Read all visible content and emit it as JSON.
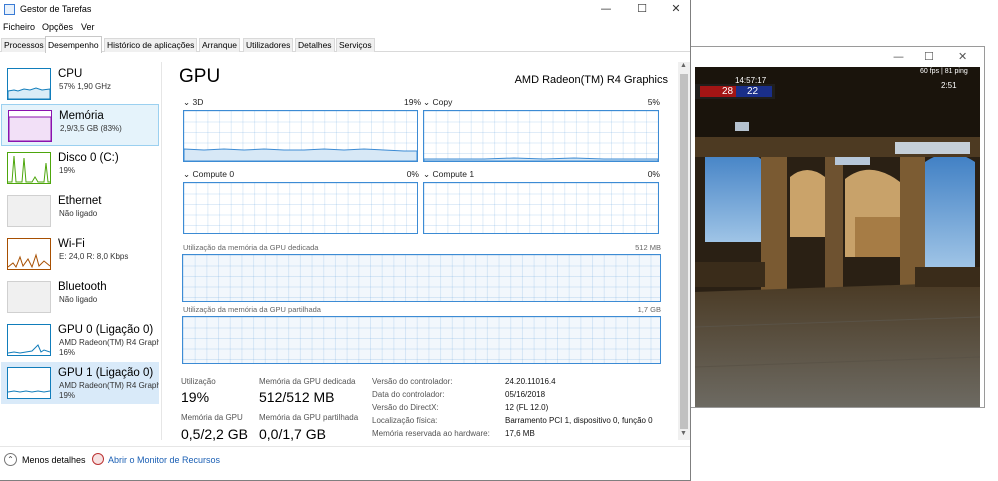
{
  "window": {
    "title": "Gestor de Tarefas",
    "minimize_glyph": "—",
    "maximize_glyph": "☐",
    "close_glyph": "✕"
  },
  "menu": [
    "Ficheiro",
    "Opções",
    "Ver"
  ],
  "tabs": [
    "Processos",
    "Desempenho",
    "Histórico de aplicações",
    "Arranque",
    "Utilizadores",
    "Detalhes",
    "Serviços"
  ],
  "sidebar": {
    "items": [
      {
        "name": "CPU",
        "sub": "57%  1,90 GHz",
        "thumb_color": "#117dbb"
      },
      {
        "name": "Memória",
        "sub": "2,9/3,5 GB (83%)",
        "thumb_color": "#8b12ae"
      },
      {
        "name": "Disco 0 (C:)",
        "sub": "19%",
        "thumb_color": "#4da60c"
      },
      {
        "name": "Ethernet",
        "sub": "Não ligado",
        "thumb_color": "#a74f01"
      },
      {
        "name": "Wi-Fi",
        "sub": "E: 24,0  R: 8,0 Kbps",
        "thumb_color": "#a74f01"
      },
      {
        "name": "Bluetooth",
        "sub": "Não ligado",
        "thumb_color": "#a74f01"
      },
      {
        "name": "GPU 0 (Ligação 0)",
        "sub": "AMD Radeon(TM) R4 Graphics",
        "sub2": "16%",
        "thumb_color": "#117dbb"
      },
      {
        "name": "GPU 1 (Ligação 0)",
        "sub": "AMD Radeon(TM) R4 Graphics",
        "sub2": "19%",
        "thumb_color": "#117dbb"
      }
    ]
  },
  "main": {
    "title": "GPU",
    "model": "AMD Radeon(TM) R4 Graphics",
    "engines": [
      {
        "name": "3D",
        "value": "19%"
      },
      {
        "name": "Copy",
        "value": "5%"
      },
      {
        "name": "Compute 0",
        "value": "0%"
      },
      {
        "name": "Compute 1",
        "value": "0%"
      }
    ],
    "dedicated": {
      "label": "Utilização da memória da GPU dedicada",
      "max": "512 MB"
    },
    "shared": {
      "label": "Utilização da memória da GPU partilhada",
      "max": "1,7 GB"
    },
    "stats": {
      "utilizacao_label": "Utilização",
      "utilizacao_value": "19%",
      "dedicada_label": "Memória da GPU dedicada",
      "dedicada_value": "512/512 MB",
      "memoria_label": "Memória da GPU",
      "memoria_value": "0,5/2,2 GB",
      "partilhada_label": "Memória da GPU partilhada",
      "partilhada_value": "0,0/1,7 GB"
    },
    "details": [
      {
        "key": "Versão do controlador:",
        "value": "24.20.11016.4"
      },
      {
        "key": "Data do controlador:",
        "value": "05/16/2018"
      },
      {
        "key": "Versão do DirectX:",
        "value": "12 (FL 12.0)"
      },
      {
        "key": "Localização física:",
        "value": "Barramento PCI 1, dispositivo 0, função 0"
      },
      {
        "key": "Memória reservada ao hardware:",
        "value": "17,6 MB"
      }
    ]
  },
  "footer": {
    "less_details": "Menos detalhes",
    "resource_monitor": "Abrir o Monitor de Recursos"
  },
  "game": {
    "fps": "60 fps  |  81 ping",
    "clock": "14:57:17",
    "score_t": "28",
    "score_ct": "22",
    "timer": "2:51"
  },
  "colors": {
    "accent": "#3c8bd4",
    "selected": "#d9eaf9"
  }
}
